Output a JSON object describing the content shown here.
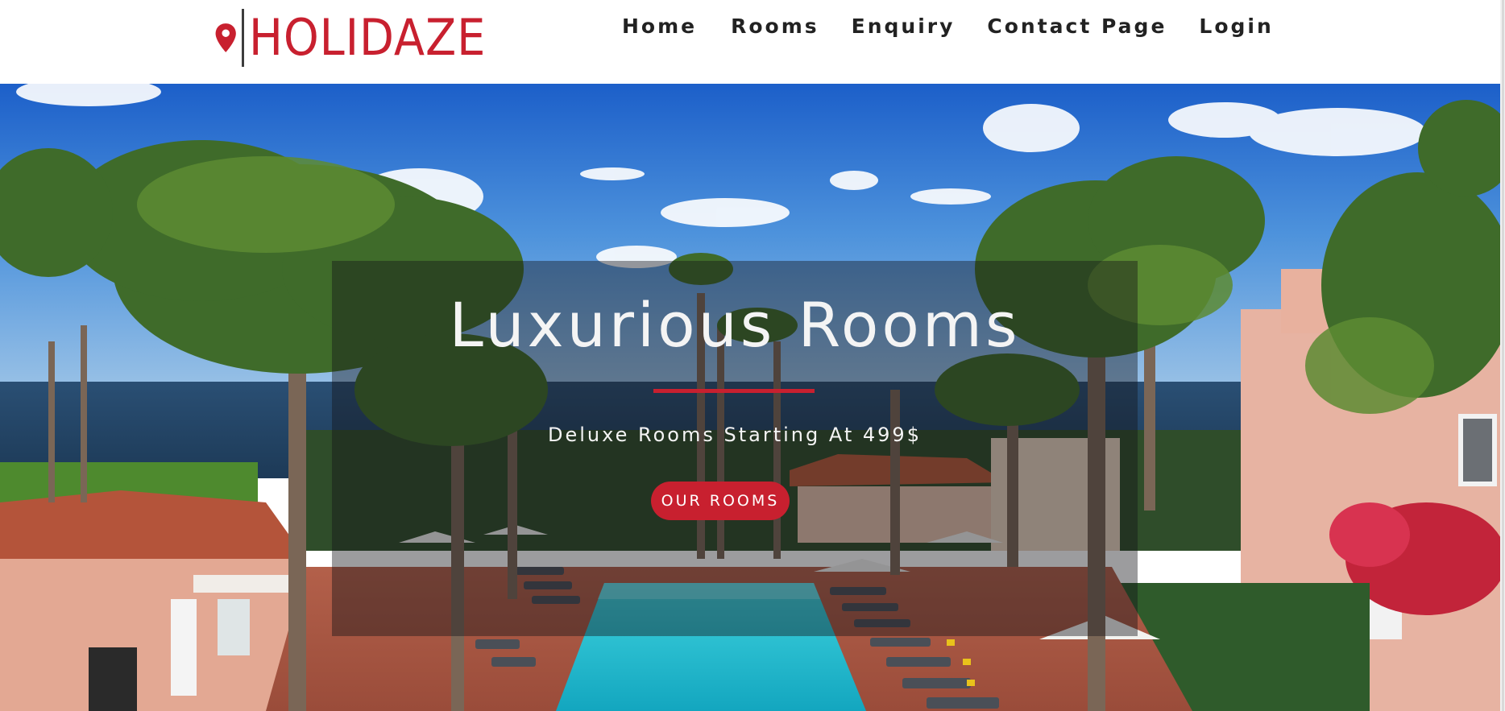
{
  "brand": {
    "name": "HOLIDAZE",
    "icon": "map-pin-icon",
    "color": "#c8202f"
  },
  "nav": {
    "items": [
      {
        "label": "Home"
      },
      {
        "label": "Rooms"
      },
      {
        "label": "Enquiry"
      },
      {
        "label": "Contact Page"
      },
      {
        "label": "Login"
      }
    ]
  },
  "hero": {
    "title": "Luxurious Rooms",
    "subtitle": "Deluxe Rooms Starting At 499$",
    "cta_label": "OUR ROOMS",
    "accent_color": "#c8202f",
    "background": "resort-pool-palm-trees-photo"
  }
}
